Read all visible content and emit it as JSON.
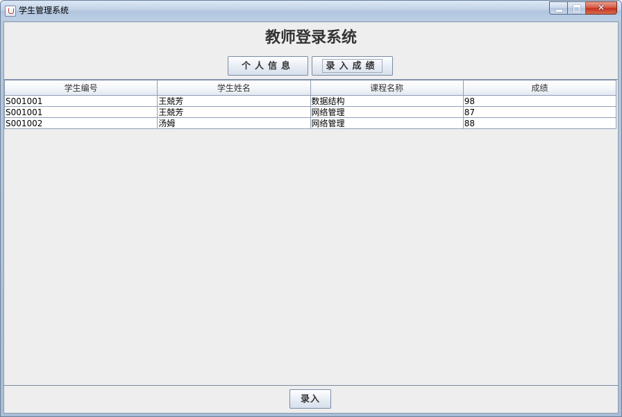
{
  "window": {
    "title": "学生管理系统"
  },
  "main": {
    "heading": "教师登录系统",
    "tabs": [
      {
        "label": "个人信息"
      },
      {
        "label": "录入成绩"
      }
    ]
  },
  "table": {
    "columns": [
      "学生编号",
      "学生姓名",
      "课程名称",
      "成绩"
    ],
    "rows": [
      [
        "S001001",
        "王兢芳",
        "数据结构",
        "98"
      ],
      [
        "S001001",
        "王兢芳",
        "网络管理",
        "87"
      ],
      [
        "S001002",
        "汤姆",
        "网络管理",
        "88"
      ]
    ]
  },
  "footer": {
    "enter_label": "录入"
  }
}
